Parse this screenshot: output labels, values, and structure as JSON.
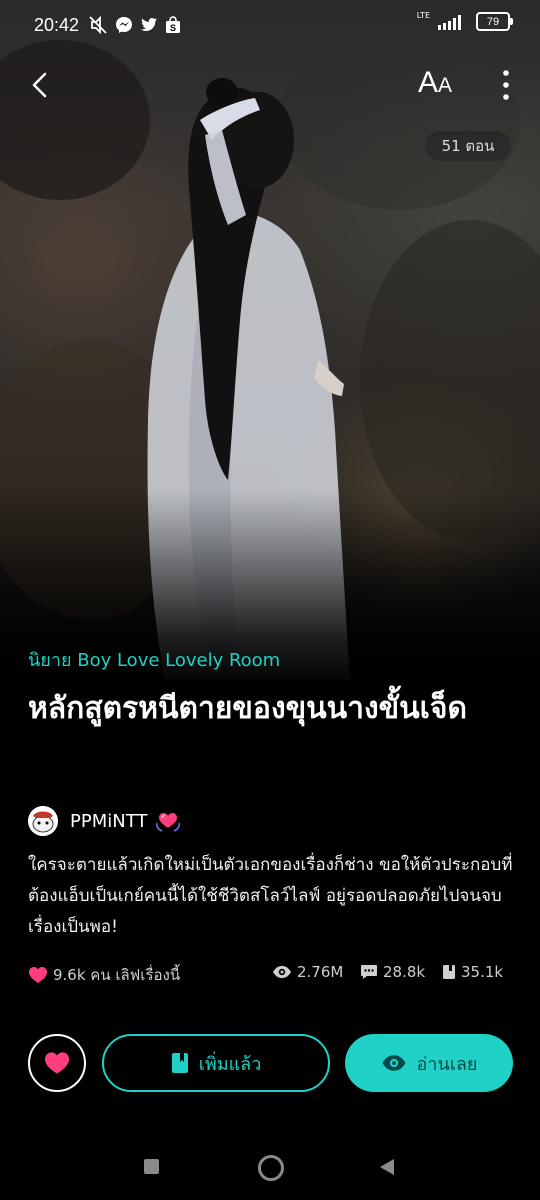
{
  "status_bar": {
    "time": "20:42",
    "network": "LTE",
    "battery": "79"
  },
  "header": {
    "font_button_big": "A",
    "font_button_small": "A",
    "episode_count": "51 ตอน"
  },
  "story": {
    "category": "นิยาย Boy Love Lovely Room",
    "title": "หลักสูตรหนีตายของขุนนางขั้นเจ็ด",
    "author": "PPMiNTT",
    "description": "ใครจะตายแล้วเกิดใหม่เป็นตัวเอกของเรื่องก็ช่าง ขอให้ตัวประกอบที่ต้องแอ็บเป็นเกย์คนนี้ได้ใช้ชีวิตสโลว์ไลฟ์ อยู่รอดปลอดภัยไปจนจบเรื่องเป็นพอ!"
  },
  "stats": {
    "likes": "9.6k คน เลิฟเรื่องนี้",
    "views": "2.76M",
    "comments": "28.8k",
    "bookmarks": "35.1k"
  },
  "actions": {
    "added_label": "เพิ่มแล้ว",
    "read_label": "อ่านเลย"
  },
  "colors": {
    "accent": "#1fd1c6",
    "heart": "#ff3d7f",
    "background": "#000000"
  }
}
